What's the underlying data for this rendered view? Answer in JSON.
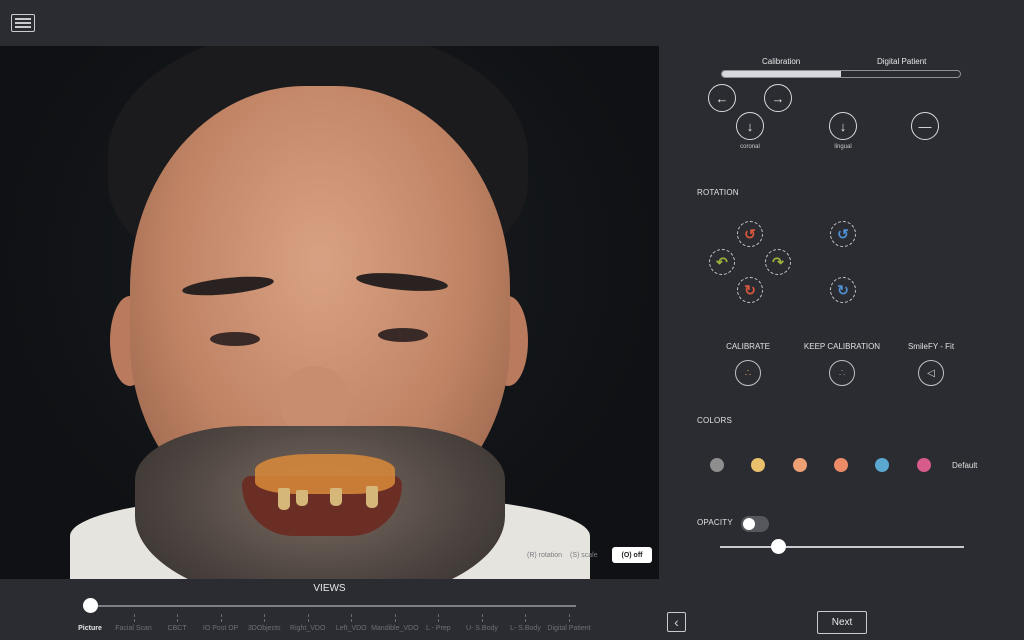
{
  "topbar": {
    "menu_icon": "hamburger-menu-icon"
  },
  "photo_controls": {
    "items": [
      "(R) rotation",
      "(S) scale"
    ],
    "off_button": "(O) off"
  },
  "views": {
    "title": "VIEWS",
    "selected_index": 0,
    "items": [
      "Picture",
      "Facial Scan",
      "CBCT",
      "IO Post OP",
      "3DObjects",
      "Right_VDO",
      "Left_VDO",
      "Mandible_VDO",
      "L - Prep",
      "U- S.Body",
      "L- S.Body",
      "Digital Patient"
    ]
  },
  "panel": {
    "tabs": {
      "calibration": "Calibration",
      "digital_patient": "Digital Patient"
    },
    "tab_progress": 0.5,
    "translation": {
      "left_icon": "arrow-left-icon",
      "right_icon": "arrow-right-icon",
      "down_icon": "arrow-down-icon",
      "dash_icon": "minus-icon",
      "coronal_label": "coronal",
      "lingual_label": "lingual"
    },
    "rotation": {
      "title": "ROTATION"
    },
    "tools": {
      "calibrate": "CALIBRATE",
      "keep_calibration": "KEEP CALIBRATION",
      "smilefy_fit": "SmileFY - Fit"
    },
    "colors": {
      "title": "COLORS",
      "swatches": [
        "#8e8e8e",
        "#e9c06b",
        "#eba173",
        "#ec8b68",
        "#5aa8cf",
        "#d85b8d"
      ],
      "default_label": "Default"
    },
    "opacity": {
      "title": "OPACITY",
      "value": 0.24
    },
    "next_label": "Next",
    "back_icon": "chevron-left-icon"
  }
}
